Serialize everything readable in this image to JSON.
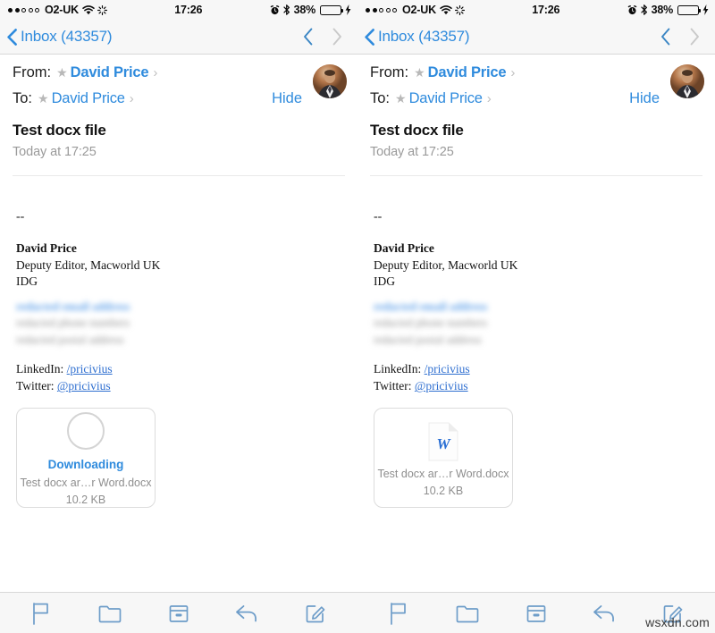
{
  "status_bar": {
    "signal_dots_filled": 2,
    "signal_dots_total": 5,
    "carrier": "O2-UK",
    "wifi_icon": "wifi-icon",
    "activity_icon": "spinner-icon",
    "time": "17:26",
    "alarm_icon": "alarm-clock-icon",
    "bluetooth_icon": "bluetooth-icon",
    "battery_percent": "38%",
    "battery_level": 38,
    "battery_color": "#4cd755",
    "charging_icon": "lightning-bolt-icon"
  },
  "nav_bar": {
    "back_icon": "chevron-left-icon",
    "back_label": "Inbox (43357)",
    "prev_icon": "chevron-up-icon",
    "next_icon": "chevron-down-icon",
    "prev_enabled_color": "#3b86c4",
    "next_disabled_color": "#c9c9c9"
  },
  "message_header": {
    "from_label": "From:",
    "from_name": "David Price",
    "to_label": "To:",
    "to_name": "David Price",
    "star_icon": "star-icon",
    "disclosure_icon": "chevron-right-icon",
    "hide_label": "Hide",
    "avatar_icon": "avatar",
    "accent_color": "#2f8bdd"
  },
  "message": {
    "subject": "Test docx file",
    "date": "Today at 17:25"
  },
  "signature": {
    "dashes": "--",
    "name": "David Price",
    "title": "Deputy Editor, Macworld UK",
    "company": "IDG",
    "redacted_lines": [
      "redacted email address",
      "redacted phone numbers",
      "redacted postal address"
    ],
    "linkedin_label": "LinkedIn:",
    "linkedin_handle": "/pricivius",
    "twitter_label": "Twitter:",
    "twitter_handle": "@pricivius"
  },
  "attachment_left": {
    "state": "downloading",
    "progress_icon": "progress-circle-icon",
    "status_label": "Downloading",
    "filename": "Test docx ar…r Word.docx",
    "filesize": "10.2 KB"
  },
  "attachment_right": {
    "state": "downloaded",
    "file_icon": "word-document-icon",
    "file_icon_letter": "W",
    "filename": "Test docx ar…r Word.docx",
    "filesize": "10.2 KB"
  },
  "toolbar": {
    "flag_label": "Flag",
    "flag_icon": "flag-icon",
    "folder_label": "Move to folder",
    "folder_icon": "folder-icon",
    "archive_label": "Archive",
    "archive_icon": "archive-box-icon",
    "reply_label": "Reply",
    "reply_icon": "reply-arrow-icon",
    "compose_label": "Compose",
    "compose_icon": "compose-pencil-icon",
    "icon_color": "#6e9dc9"
  },
  "watermark": "wsxdn.com"
}
